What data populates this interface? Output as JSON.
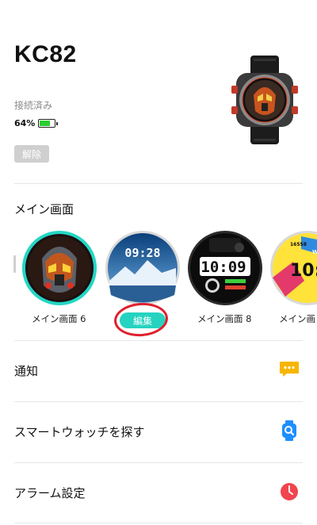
{
  "device": {
    "name": "KC82",
    "connection_status": "接続済み",
    "battery_percent": "64%",
    "battery_level": 0.64,
    "unpair_label": "解除"
  },
  "main_screen": {
    "title": "メイン画面",
    "faces": [
      {
        "label": "メイン画面 6",
        "time": "",
        "icon": "robot-helmet-face",
        "selected": true
      },
      {
        "label": "",
        "time": "09:28",
        "icon": "mountain-lake-face",
        "selected": false,
        "action": "編集"
      },
      {
        "label": "メイン画面 8",
        "time": "10:09",
        "icon": "digital-sport-face",
        "selected": false
      },
      {
        "label": "メイン画",
        "time": "10:0",
        "icon": "comic-face",
        "selected": false
      }
    ]
  },
  "menu": [
    {
      "label": "通知",
      "icon": "notification-chat-icon",
      "color": "#f7b500"
    },
    {
      "label": "スマートウォッチを探す",
      "icon": "find-watch-icon",
      "color": "#1e8fff"
    },
    {
      "label": "アラーム設定",
      "icon": "alarm-clock-icon",
      "color": "#f0454f"
    }
  ],
  "colors": {
    "accent_teal": "#26d3c0",
    "battery_green": "#2ecc2e",
    "highlight_red": "#e0202c"
  }
}
